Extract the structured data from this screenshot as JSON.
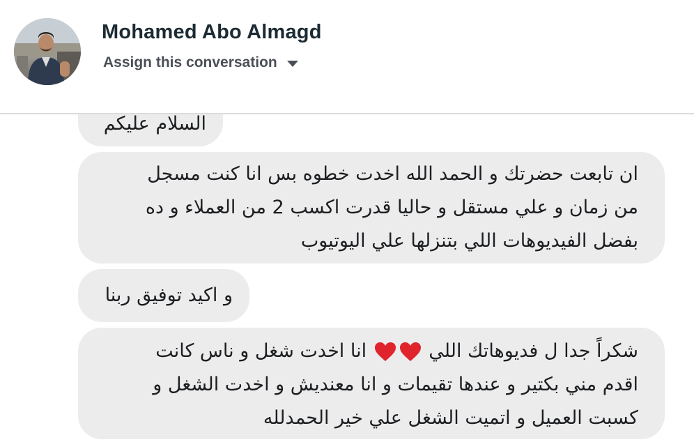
{
  "header": {
    "contact_name": "Mohamed Abo Almagd",
    "assign_label": "Assign this conversation",
    "assign_icon": "chevron-down-icon"
  },
  "messages": [
    {
      "lines": [
        "السلام عليكم"
      ]
    },
    {
      "lines": [
        "ان تابعت حضرتك و الحمد الله اخدت خطوه بس انا كنت مسجل",
        "من زمان و علي مستقل و حاليا قدرت اكسب 2 من العملاء و ده",
        "بفضل الفيديوهات اللي بتنزلها علي اليوتيوب"
      ]
    },
    {
      "lines": [
        "و اكيد توفيق ربنا"
      ]
    },
    {
      "line1_start": "شكراً جدا ل فديوهاتك اللي",
      "line1_end": "انا اخدت شغل و ناس كانت",
      "lines": [
        "اقدم مني بكتير و عندها تقيمات و انا معنديش و اخدت الشغل و",
        "كسبت العميل و اتميت الشغل علي خير الحمدلله"
      ],
      "emoji": "heart-icon",
      "emoji_color": "#e0242c"
    }
  ],
  "colors": {
    "bubble": "#ececec",
    "name": "#1c2b33",
    "subtle": "#4b4f56",
    "divider": "#dcdcdc"
  }
}
